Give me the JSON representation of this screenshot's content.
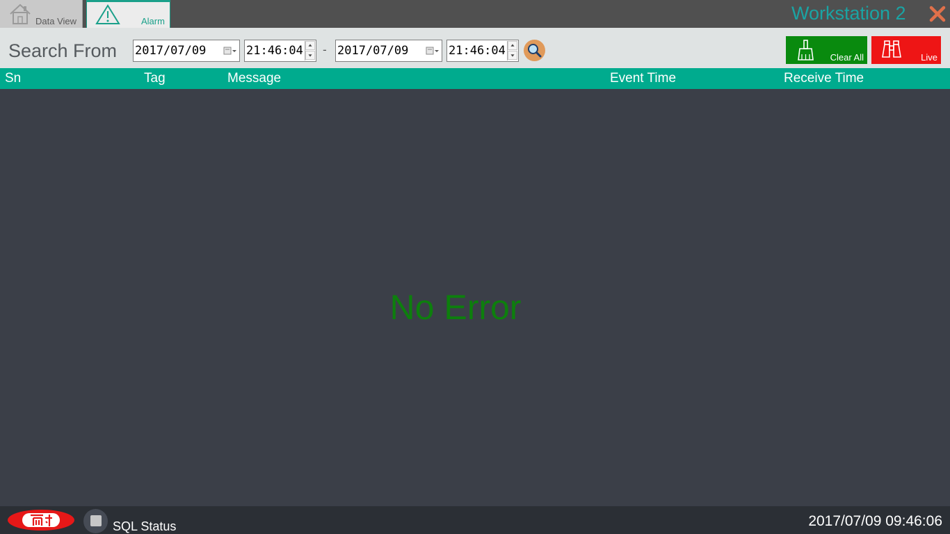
{
  "tabs": [
    {
      "label": "Data View",
      "icon": "home-icon"
    },
    {
      "label": "Alarm",
      "icon": "warning-icon"
    }
  ],
  "window": {
    "title": "Workstation 2",
    "close_icon": "close-icon"
  },
  "search": {
    "label": "Search From",
    "from_date": "2017/07/09",
    "from_time": "21:46:04",
    "separator": "-",
    "to_date": "2017/07/09",
    "to_time": "21:46:04",
    "search_icon": "search-icon"
  },
  "actions": {
    "clear_all": "Clear All",
    "live": "Live"
  },
  "columns": [
    "Sn",
    "Tag",
    "Message",
    "Event Time",
    "Receive Time"
  ],
  "content": {
    "empty_message": "No Error"
  },
  "status": {
    "sql_label": "SQL Status",
    "clock": "2017/07/09 09:46:06"
  },
  "colors": {
    "accent": "#00ab8e",
    "title": "#1aa4a4",
    "close": "#e0704a",
    "clear_button": "#098a0e",
    "live_button": "#ee1515",
    "no_error": "#0d7f0d",
    "background": "#3b3f48"
  }
}
